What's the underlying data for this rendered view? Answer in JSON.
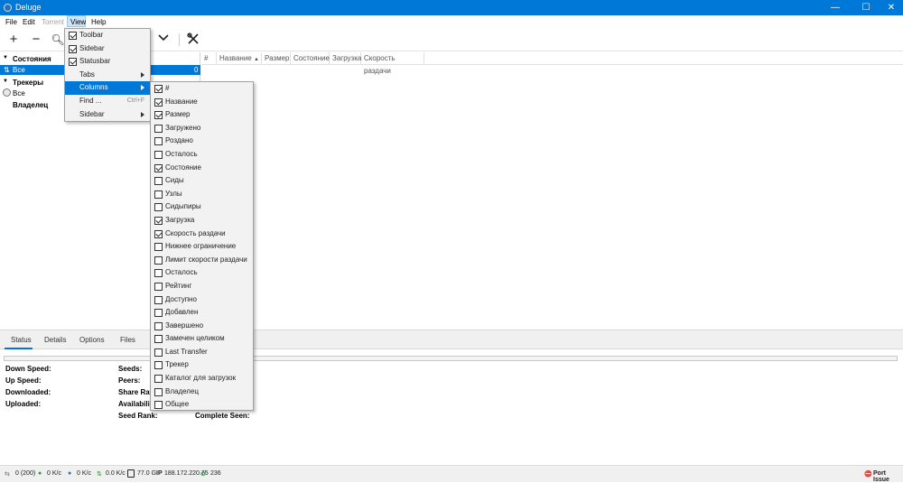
{
  "window": {
    "title": "Deluge",
    "minimize": "—",
    "maximize": "☐",
    "close": "✕"
  },
  "menubar": {
    "file": "File",
    "edit": "Edit",
    "torrent": "Torrent",
    "view": "View",
    "help": "Help"
  },
  "sidebar": {
    "states_header": "Состояния",
    "all_label": "Все",
    "all_count": "0",
    "trackers_header": "Трекеры",
    "trackers_all": "Все",
    "owner_header": "Владелец"
  },
  "columns": [
    "#",
    "Название",
    "Размер",
    "Состояние",
    "Загрузка",
    "Скорость раздачи"
  ],
  "view_menu": {
    "items": [
      {
        "label": "Toolbar",
        "checked": true
      },
      {
        "label": "Sidebar",
        "checked": true
      },
      {
        "label": "Statusbar",
        "checked": true
      },
      {
        "label": "Tabs",
        "submenu": true
      },
      {
        "label": "Columns",
        "submenu": true,
        "highlighted": true
      },
      {
        "label": "Find ...",
        "shortcut": "Ctrl+F"
      },
      {
        "label": "Sidebar",
        "submenu": true
      }
    ]
  },
  "columns_menu": {
    "items": [
      {
        "label": "#",
        "checked": true
      },
      {
        "label": "Название",
        "checked": true
      },
      {
        "label": "Размер",
        "checked": true
      },
      {
        "label": "Загружено",
        "checked": false
      },
      {
        "label": "Роздано",
        "checked": false
      },
      {
        "label": "Осталось",
        "checked": false
      },
      {
        "label": "Состояние",
        "checked": true
      },
      {
        "label": "Сиды",
        "checked": false
      },
      {
        "label": "Узлы",
        "checked": false
      },
      {
        "label": "Сидыпиры",
        "checked": false
      },
      {
        "label": "Загрузка",
        "checked": true
      },
      {
        "label": "Скорость раздачи",
        "checked": true
      },
      {
        "label": "Нижнее ограничение",
        "checked": false
      },
      {
        "label": "Лимит скорости раздачи",
        "checked": false
      },
      {
        "label": "Осталось",
        "checked": false
      },
      {
        "label": "Рейтинг",
        "checked": false
      },
      {
        "label": "Доступно",
        "checked": false
      },
      {
        "label": "Добавлен",
        "checked": false
      },
      {
        "label": "Завершено",
        "checked": false
      },
      {
        "label": "Замечен целиком",
        "checked": false
      },
      {
        "label": "Last Transfer",
        "checked": false
      },
      {
        "label": "Трекер",
        "checked": false
      },
      {
        "label": "Каталог для загрузок",
        "checked": false
      },
      {
        "label": "Владелец",
        "checked": false
      },
      {
        "label": "Общее",
        "checked": false
      }
    ]
  },
  "tabs": {
    "status": "Status",
    "details": "Details",
    "options": "Options",
    "files": "Files"
  },
  "status_fields": {
    "down_speed": "Down Speed:",
    "up_speed": "Up Speed:",
    "downloaded": "Downloaded:",
    "uploaded": "Uploaded:",
    "seeds": "Seeds:",
    "peers": "Peers:",
    "share_ratio": "Share Ratio:",
    "availability": "Availability:",
    "seed_rank": "Seed Rank:",
    "complete_seen": "Complete Seen:"
  },
  "statusbar": {
    "connections": "0 (200)",
    "down": "0 K/c",
    "up": "0 K/c",
    "protocol": "0.0 K/c",
    "disk": "77.0 G",
    "ip_label": "IP",
    "ip": "188.172.220.75",
    "dht": "236",
    "port_issue": "Port Issue"
  }
}
